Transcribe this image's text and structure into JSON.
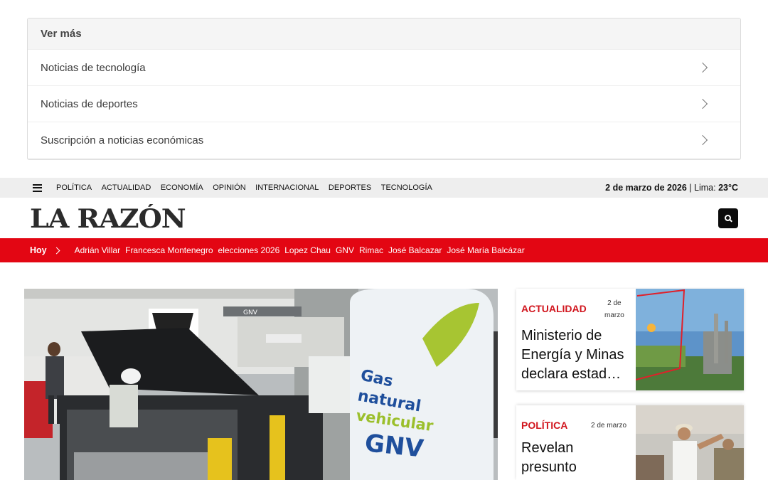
{
  "ver_mas": {
    "title": "Ver más",
    "items": [
      {
        "label": "Noticias de tecnología"
      },
      {
        "label": "Noticias de deportes"
      },
      {
        "label": "Suscripción a noticias económicas"
      }
    ]
  },
  "topbar": {
    "nav": [
      "POLÍTICA",
      "ACTUALIDAD",
      "ECONOMÍA",
      "OPINIÓN",
      "INTERNACIONAL",
      "DEPORTES",
      "TECNOLOGÍA"
    ],
    "date": "2 de marzo de 2026",
    "separator": " | Lima: ",
    "temperature": "23°C"
  },
  "header": {
    "logo": "LA RAZÓN"
  },
  "trending": {
    "label": "Hoy",
    "tags": [
      "Adrián Villar",
      "Francesca Montenegro",
      "elecciones 2026",
      "Lopez Chau",
      "GNV",
      "Rimac",
      "José Balcazar",
      "José María Balcázar"
    ]
  },
  "main_story": {
    "image_text": {
      "line1": "Gas",
      "line2": "natural",
      "line3": "vehicular",
      "line4": "GNV",
      "sign": "GNV"
    }
  },
  "side_stories": [
    {
      "category": "ACTUALIDAD",
      "date_line1": "2 de",
      "date_line2": "marzo",
      "headline": "Ministerio de Energía y Minas declara estad…"
    },
    {
      "category": "POLÍTICA",
      "date": "2 de marzo",
      "headline": "Revelan presunto"
    }
  ],
  "colors": {
    "brand_red": "#e30613",
    "category_red": "#d1161e"
  }
}
